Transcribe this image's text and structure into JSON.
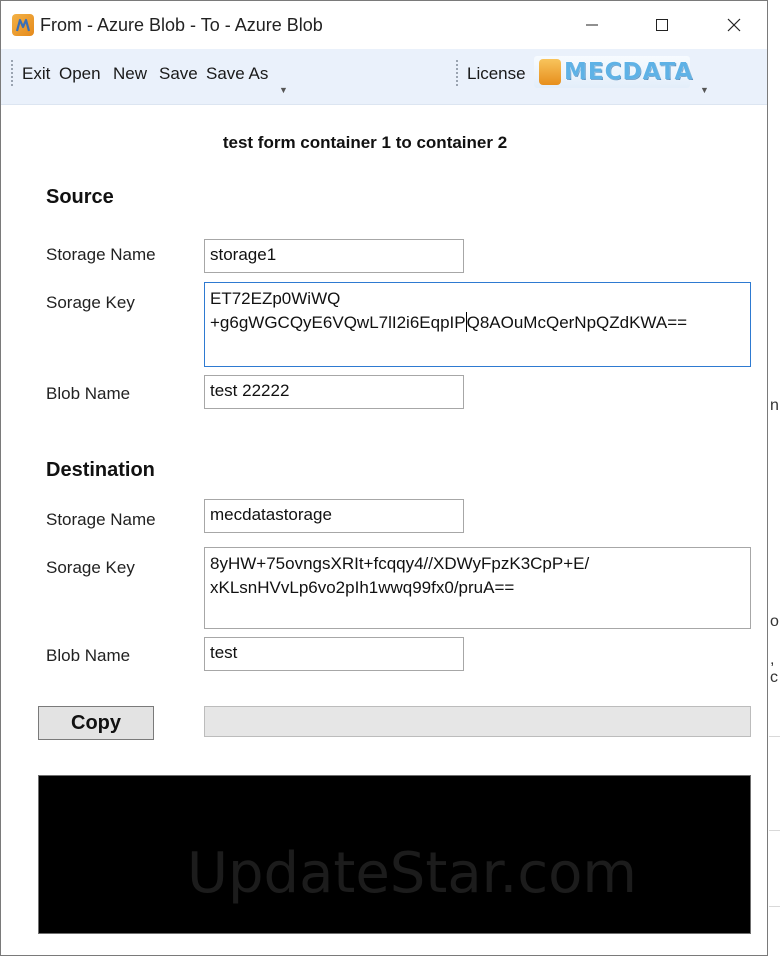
{
  "window": {
    "title": "From - Azure Blob - To - Azure Blob",
    "controls": [
      "minimize",
      "maximize",
      "close"
    ]
  },
  "toolbar": {
    "items": [
      "Exit",
      "Open",
      "New",
      "Save",
      "Save As"
    ],
    "license_label": "License",
    "logo_text": "MECDATA"
  },
  "form": {
    "title": "test form container 1 to container 2",
    "source": {
      "heading": "Source",
      "storage_name_label": "Storage Name",
      "storage_name_value": "storage1",
      "storage_key_label": "Sorage Key",
      "storage_key_before_caret": "ET72EZp0WiWQ\n+g6gWGCQyE6VQwL7lI2i6EqpIP",
      "storage_key_after_caret": "Q8AOuMcQerNpQZdKWA==",
      "blob_name_label": "Blob Name",
      "blob_name_value": "test 22222"
    },
    "destination": {
      "heading": "Destination",
      "storage_name_label": "Storage Name",
      "storage_name_value": "mecdatastorage",
      "storage_key_label": "Sorage Key",
      "storage_key_value": "8yHW+75ovngsXRIt+fcqqy4//XDWyFpzK3CpP+E/\nxKLsnHVvLp6vo2pIh1wwq99fx0/pruA==",
      "blob_name_label": "Blob Name",
      "blob_name_value": "test"
    },
    "copy_label": "Copy",
    "progress_fraction": 0
  },
  "output": {
    "watermark": "UpdateStar.com"
  },
  "colors": {
    "toolbar_bg": "#eaf1fb",
    "focus_border": "#2e7ad1",
    "console_bg": "#000000"
  }
}
